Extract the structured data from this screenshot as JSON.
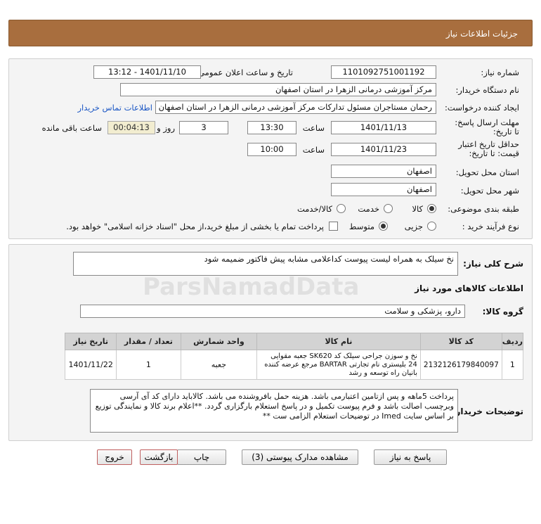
{
  "header": {
    "title": "جزئیات اطلاعات نیاز"
  },
  "form": {
    "need_number_label": "شماره نیاز:",
    "need_number": "1101092751001192",
    "announce_label": "تاریخ و ساعت اعلان عمومی:",
    "announce_value": "1401/11/10 - 13:12",
    "buyer_org_label": "نام دستگاه خریدار:",
    "buyer_org": "مرکز آموزشی درمانی الزهرا در استان اصفهان",
    "requester_label": "ایجاد کننده درخواست:",
    "requester": "رحمان مستاجران مسئول تدارکات مرکز آموزشی درمانی الزهرا در استان اصفهان",
    "contact_link": "اطلاعات تماس خریدار",
    "deadline_label": "مهلت ارسال پاسخ: تا تاریخ:",
    "deadline_date": "1401/11/13",
    "time_word": "ساعت",
    "deadline_time": "13:30",
    "days_count": "3",
    "days_and": "روز و",
    "remaining_time": "00:04:13",
    "remaining_label": "ساعت باقی مانده",
    "validity_label": "حداقل تاریخ اعتبار قیمت: تا تاریخ:",
    "validity_date": "1401/11/23",
    "validity_time": "10:00",
    "province_label": "استان محل تحویل:",
    "province": "اصفهان",
    "city_label": "شهر محل تحویل:",
    "city": "اصفهان",
    "category_label": "طبقه بندی موضوعی:",
    "category_options": [
      "کالا",
      "خدمت",
      "کالا/خدمت"
    ],
    "process_label": "نوع فرآیند خرید :",
    "process_options": [
      "جزیی",
      "متوسط"
    ],
    "payment_note": "پرداخت تمام یا بخشی از مبلغ خرید،از محل \"اسناد خزانه اسلامی\" خواهد بود."
  },
  "detail": {
    "summary_label": "شرح کلی نیاز:",
    "summary": "نخ سیلک به همراه  لیست پیوست کداعلامی مشابه پیش فاکتور ضمیمه شود",
    "goods_info_title": "اطلاعات کالاهای مورد نیاز",
    "goods_group_label": "گروه کالا:",
    "goods_group": "دارو، پزشکی و سلامت",
    "table": {
      "headers": [
        "ردیف",
        "کد کالا",
        "نام کالا",
        "واحد شمارش",
        "تعداد / مقدار",
        "تاریخ نیاز"
      ],
      "rows": [
        {
          "row": "1",
          "code": "2132126179840097",
          "name": "نخ و سوزن جراحی سیلک کد SK620 جعبه مقوایی 24 بلیستری نام تجارتی BARTAR مرجع عرضه کننده بانیان راه توسعه و رشد",
          "unit": "جعبه",
          "qty": "1",
          "date": "1401/11/22"
        }
      ]
    },
    "buyer_notes_label": "توضیحات خریدار:",
    "buyer_notes": "پرداخت 5ماهه و پس ازتامین اعتبارمی باشد. هزینه حمل بافروشنده می باشد. کالاباید دارای کد آی آرسی وبرچسب اصالت باشد و فرم پیوست تکمیل و در پاسخ استعلام بارگزاری گردد. **اعلام برند کالا و نمایندگی توزیع بر اساس سایت Imed در توضیحات استعلام الزامی ست **"
  },
  "buttons": {
    "reply": "پاسخ به نیاز",
    "attachments": "مشاهده مدارک پیوستی (3)",
    "print": "چاپ",
    "back": "بازگشت",
    "exit": "خروج"
  },
  "colors": {
    "header_bg": "#a86e3e",
    "link": "#1a56c4",
    "timer_bg": "#f2edd0"
  }
}
